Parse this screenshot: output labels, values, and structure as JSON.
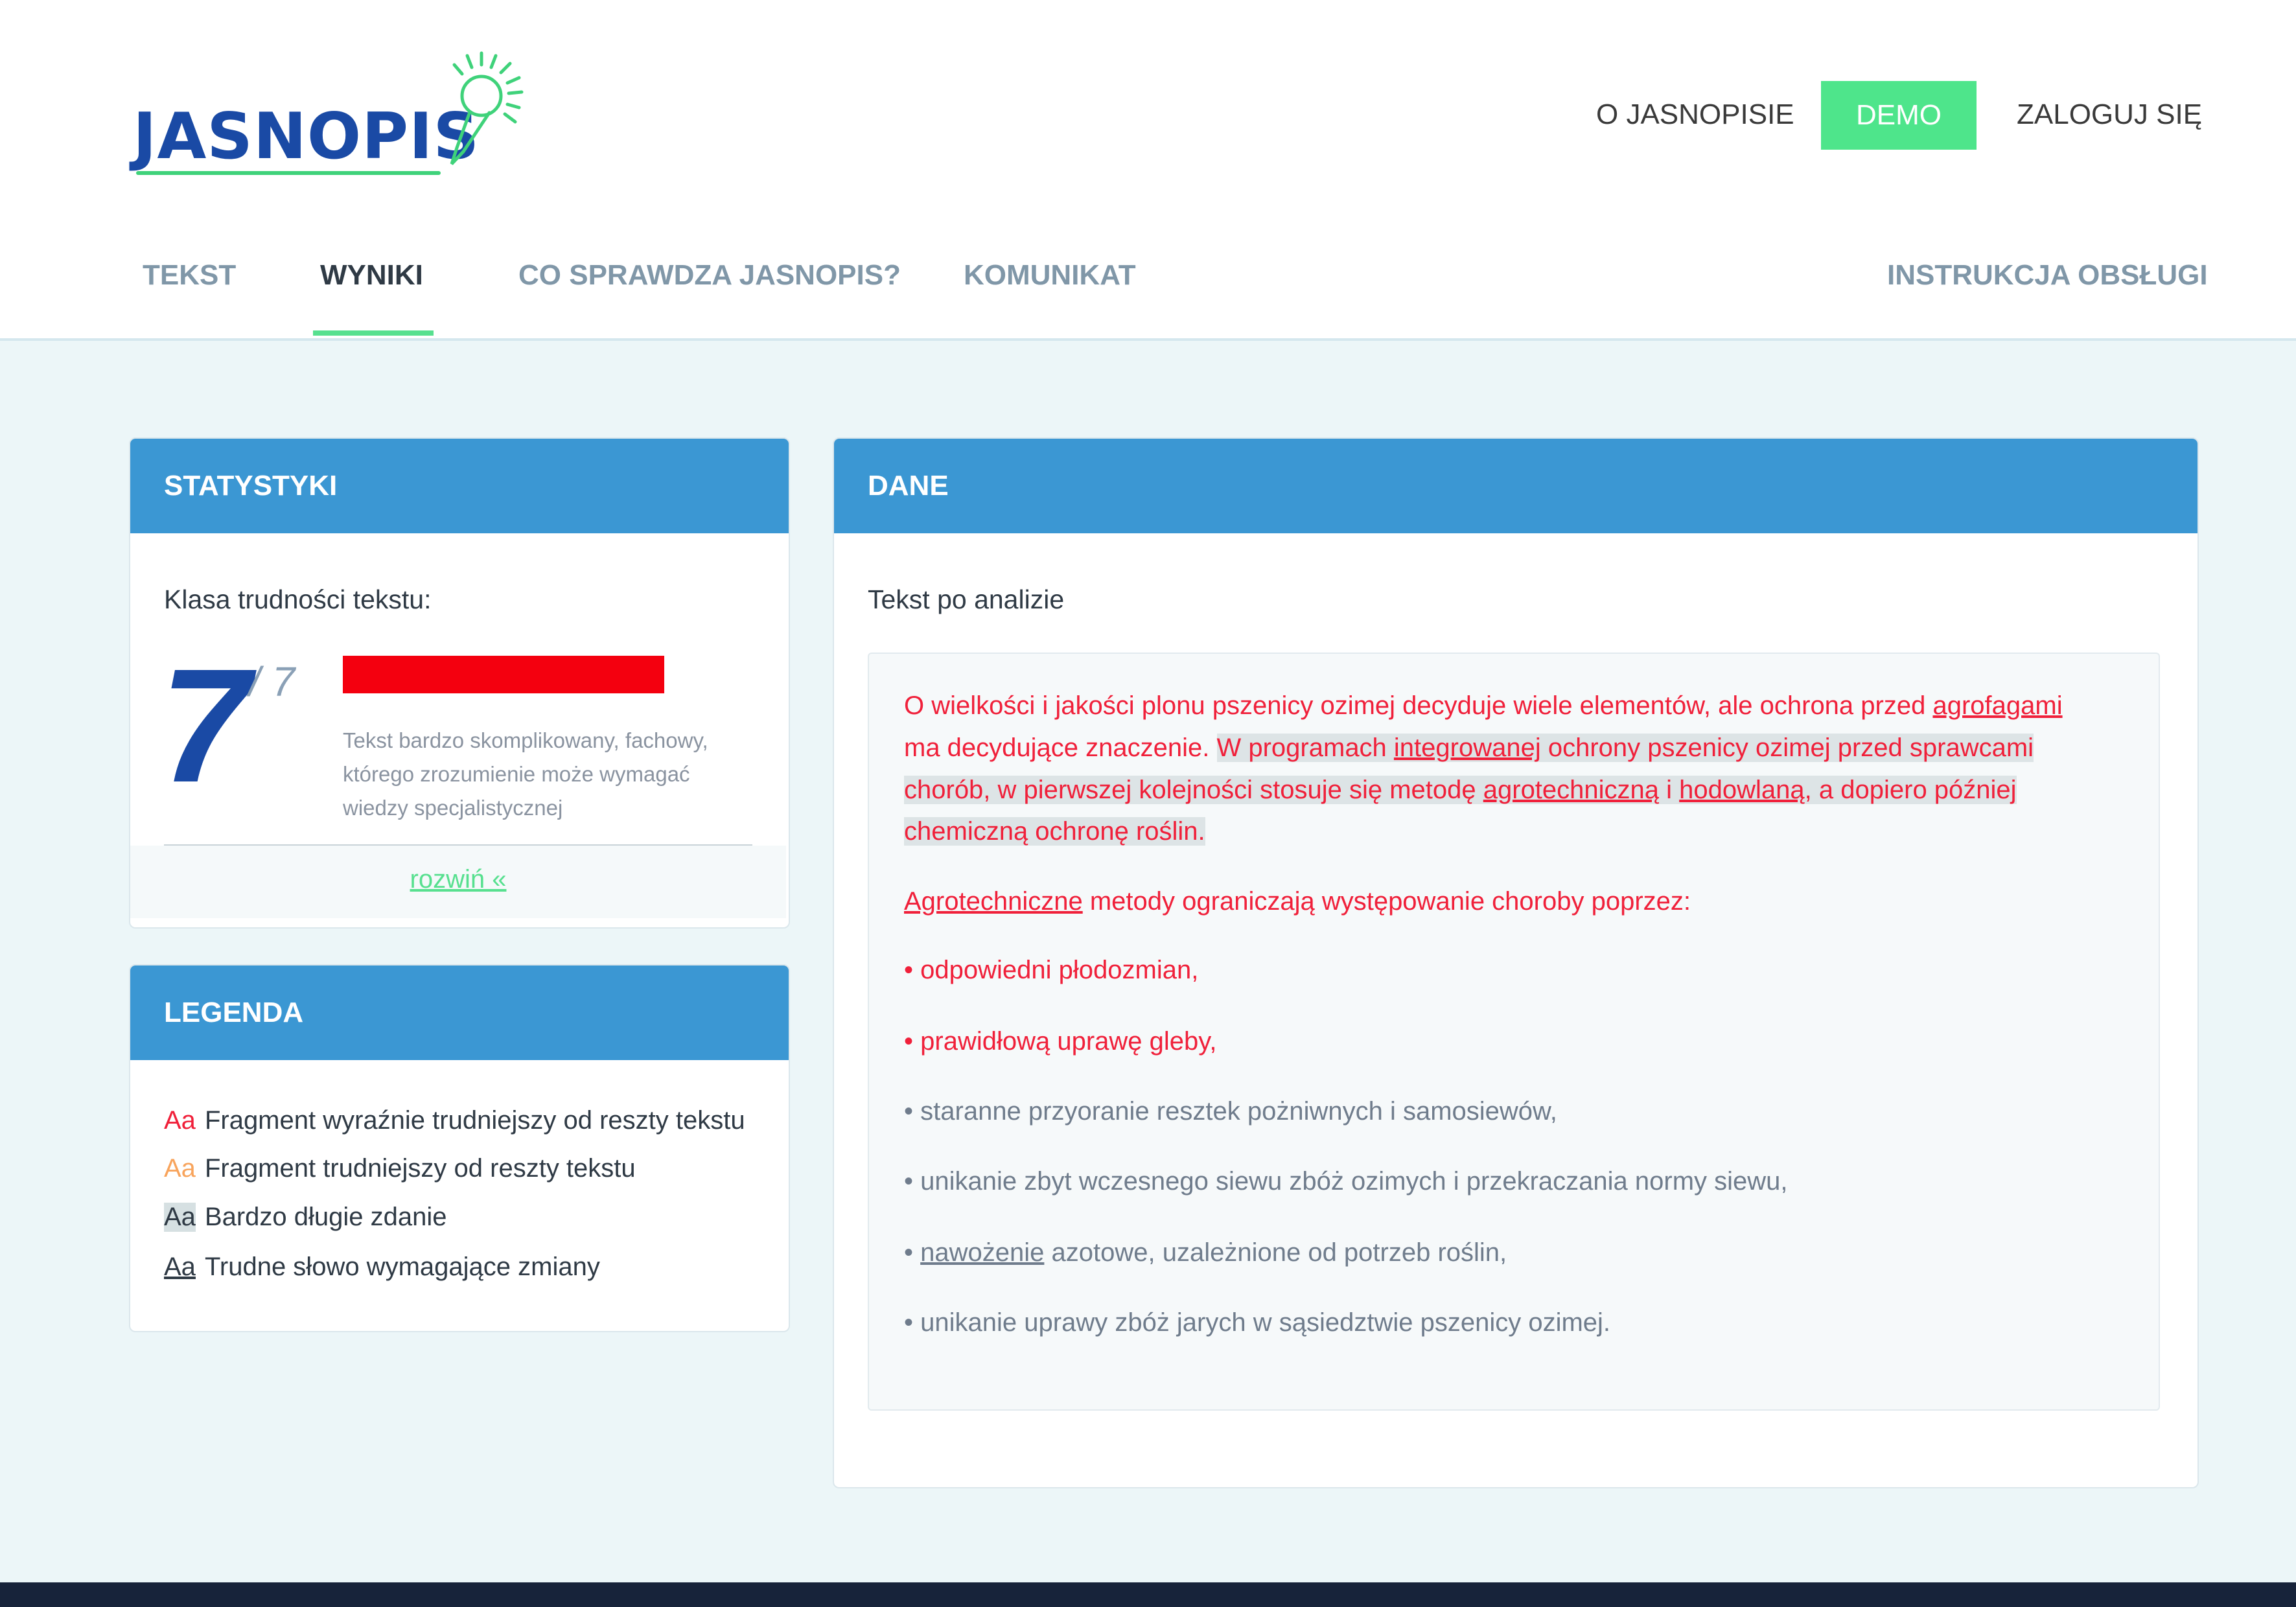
{
  "logo": {
    "text": "JASNOPIS"
  },
  "topnav": {
    "about": "O JASNOPISIE",
    "demo": "DEMO",
    "login": "ZALOGUJ SIĘ"
  },
  "tabs": {
    "text": "TEKST",
    "results": "WYNIKI",
    "checks": "CO SPRAWDZA JASNOPIS?",
    "message": "KOMUNIKAT",
    "manual": "INSTRUKCJA OBSŁUGI"
  },
  "colors": {
    "accent_green": "#4ee58b",
    "header_blue": "#3b97d3",
    "logo_blue": "#1a4aa5",
    "difficulty_red": "#f4000f"
  },
  "stats": {
    "title": "STATYSTYKI",
    "label": "Klasa trudności tekstu:",
    "value": "7",
    "max": "/ 7",
    "difficulty_fraction": 1.0,
    "desc_lines": [
      "Tekst bardzo skomplikowany, fachowy,",
      "którego zrozumienie może wymagać",
      "wiedzy specjalistycznej"
    ],
    "expand": "rozwiń «"
  },
  "legend": {
    "title": "LEGENDA",
    "sample": "Aa",
    "items": [
      "Fragment wyraźnie trudniejszy od reszty tekstu",
      "Fragment trudniejszy od reszty tekstu",
      "Bardzo długie zdanie",
      "Trudne słowo wymagające zmiany"
    ]
  },
  "data_panel": {
    "title": "DANE",
    "label": "Tekst po analizie",
    "p1": {
      "l1a": "O wielkości i jakości plonu pszenicy ozimej decyduje wiele elementów, ale ochrona przed ",
      "l1b": "agrofagami",
      "l2a": "ma decydujące znaczenie. ",
      "l2b": "W programach ",
      "l2c": "integrowanej",
      "l2d": " ochrony pszenicy ozimej przed sprawcami",
      "l3a": "chorób, w pierwszej kolejności stosuje się metodę ",
      "l3b": "agrotechniczną",
      "l3c": " i ",
      "l3d": "hodowlaną",
      "l3e": ", a dopiero później",
      "l4": "chemiczną ochronę roślin."
    },
    "p2a": "Agrotechniczne",
    "p2b": " metody ograniczają występowanie choroby poprzez:",
    "bullet": "•",
    "b1": "odpowiedni płodozmian,",
    "b2": "prawidłową uprawę gleby,",
    "b3": "staranne przyoranie resztek pożniwnych i samosiewów,",
    "b4": "unikanie zbyt wczesnego siewu zbóż ozimych i przekraczania normy siewu,",
    "b5a": "nawożenie",
    "b5b": " azotowe, uzależnione od potrzeb roślin,",
    "b6": "unikanie uprawy zbóż jarych w sąsiedztwie pszenicy ozimej."
  }
}
